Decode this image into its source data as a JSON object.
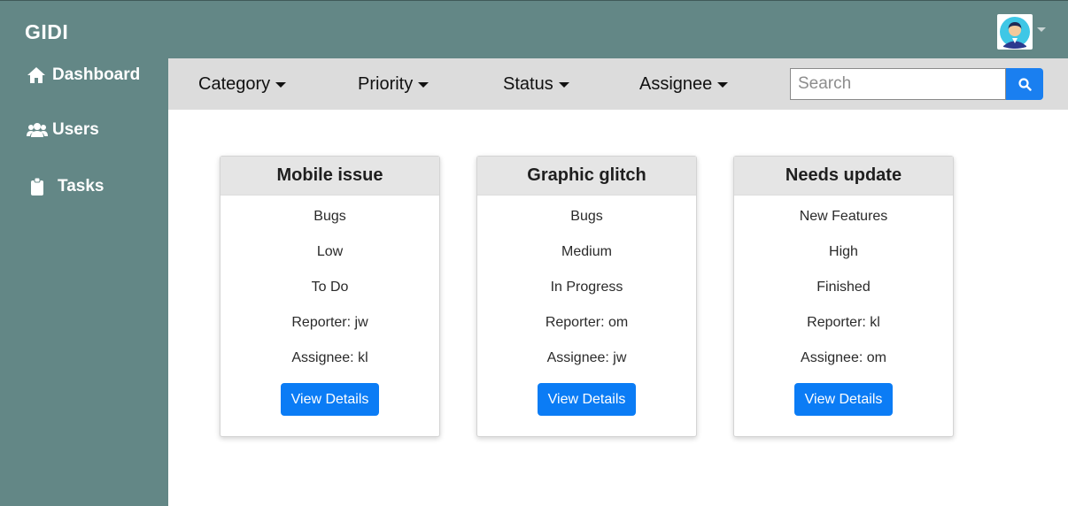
{
  "app": {
    "brand": "GIDI"
  },
  "header": {
    "avatar_icon": "user-avatar"
  },
  "sidebar": {
    "items": [
      {
        "label": "Dashboard",
        "icon": "home-icon"
      },
      {
        "label": "Users",
        "icon": "users-icon"
      },
      {
        "label": "Tasks",
        "icon": "clipboard-icon"
      }
    ]
  },
  "filters": {
    "category": "Category",
    "priority": "Priority",
    "status": "Status",
    "assignee": "Assignee"
  },
  "search": {
    "placeholder": "Search",
    "value": "",
    "icon": "search-icon"
  },
  "tasks": [
    {
      "title": "Mobile issue",
      "category": "Bugs",
      "priority": "Low",
      "status": "To Do",
      "reporter": "Reporter: jw",
      "assignee": "Assignee: kl",
      "button": "View Details"
    },
    {
      "title": "Graphic glitch",
      "category": "Bugs",
      "priority": "Medium",
      "status": "In Progress",
      "reporter": "Reporter: om",
      "assignee": "Assignee: jw",
      "button": "View Details"
    },
    {
      "title": "Needs update",
      "category": "New Features",
      "priority": "High",
      "status": "Finished",
      "reporter": "Reporter: kl",
      "assignee": "Assignee: om",
      "button": "View Details"
    }
  ],
  "colors": {
    "sidebar": "#638786",
    "filterbar": "#dcdcdc",
    "primary": "#0b7cf5",
    "card_header": "#e5e5e5"
  }
}
